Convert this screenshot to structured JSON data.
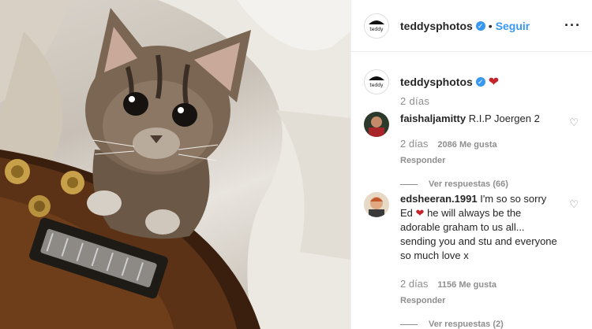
{
  "post": {
    "username": "teddysphotos",
    "verified_mark": "✓",
    "separator": "•",
    "follow_label": "Seguir",
    "more_label": "···",
    "caption_icon": "red-heart",
    "time": "2 días"
  },
  "comments": [
    {
      "username": "faishaljamitty",
      "text": "R.I.P Joergen 2",
      "time": "2 días",
      "likes": "2086 Me gusta",
      "reply_label": "Responder",
      "view_replies": "Ver respuestas (66)"
    },
    {
      "username": "edsheeran.1991",
      "text_before": "I'm so so sorry Ed",
      "text_after": "he will always be the adorable graham to us all... sending you and stu and everyone so much love x",
      "time": "2 días",
      "likes": "1156 Me gusta",
      "reply_label": "Responder",
      "view_replies": "Ver respuestas (2)"
    }
  ],
  "colors": {
    "link": "#3897f0",
    "heart": "#c4242b",
    "muted": "#8e8e8e"
  }
}
